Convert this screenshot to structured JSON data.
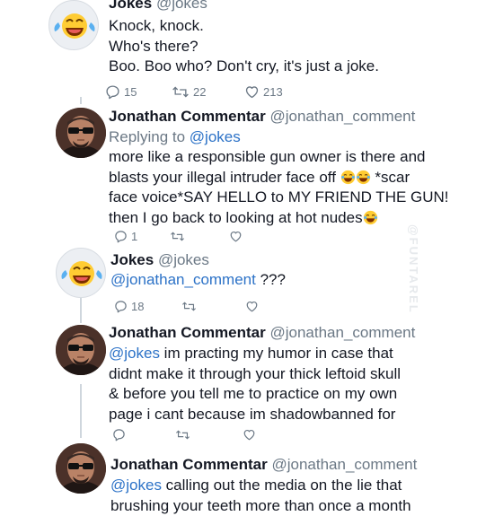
{
  "watermark": "@FUNTAREL",
  "tweets": [
    {
      "name": "Jokes",
      "handle": "@jokes",
      "lines": [
        "Knock, knock.",
        "Who's there?",
        "Boo. Boo who? Don't cry, it's just a joke."
      ],
      "replies": "15",
      "retweets": "22",
      "likes": "213"
    },
    {
      "name": "Jonathan Commentar",
      "handle": "@jonathan_comment",
      "replying_prefix": "Replying to ",
      "replying_to": "@jokes",
      "lines": [
        "more like a responsible gun owner is there and",
        "blasts your illegal intruder face off",
        "*scar",
        "face voice*SAY HELLO to MY FRIEND THE GUN!",
        "then I go back to looking at hot nudes"
      ],
      "replies": "1"
    },
    {
      "name": "Jokes",
      "handle": "@jokes",
      "mention": "@jonathan_comment",
      "text": " ???",
      "replies": "18"
    },
    {
      "name": "Jonathan Commentar",
      "handle": "@jonathan_comment",
      "mention": "@jokes",
      "first_line_rest": " im practing my humor in case that",
      "lines": [
        "didnt make it through your thick leftoid skull",
        "& before you tell me to practice on my own",
        "page i cant because im shadowbanned for"
      ]
    },
    {
      "name": "Jonathan Commentar",
      "handle": "@jonathan_comment",
      "mention": "@jokes",
      "first_line_rest": " calling out the media on the lie that",
      "lines": [
        "brushing your teeth more than once a month"
      ]
    }
  ]
}
